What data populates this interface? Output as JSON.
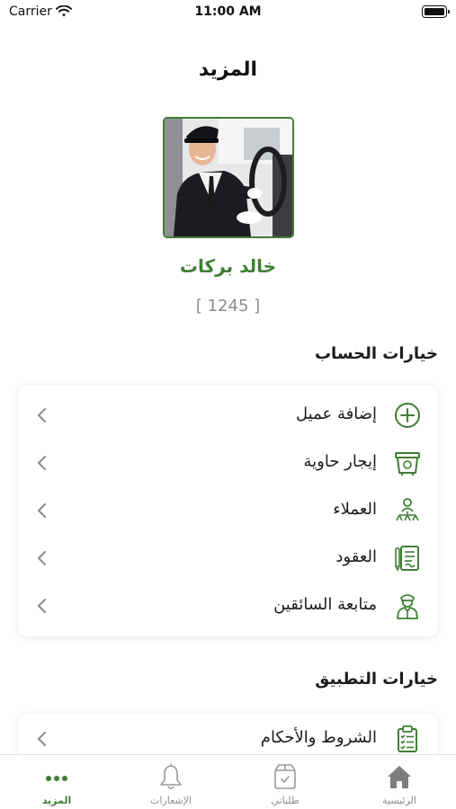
{
  "status_bar": {
    "carrier": "Carrier",
    "time": "11:00 AM"
  },
  "header": {
    "title": "المزيد"
  },
  "profile": {
    "name": "خالد بركات",
    "id_text": "[ 1245 ]"
  },
  "account_section": {
    "title": "خيارات الحساب",
    "items": [
      {
        "label": "إضافة عميل",
        "icon": "add-circle-icon"
      },
      {
        "label": "إيجار حاوية",
        "icon": "container-icon"
      },
      {
        "label": "العملاء",
        "icon": "customers-icon"
      },
      {
        "label": "العقود",
        "icon": "contracts-icon"
      },
      {
        "label": "متابعة السائقين",
        "icon": "driver-icon"
      }
    ]
  },
  "app_section": {
    "title": "خيارات التطبيق",
    "items": [
      {
        "label": "الشروط والأحكام",
        "icon": "clipboard-checklist-icon"
      }
    ]
  },
  "tab_bar": {
    "tabs": [
      {
        "label": "الرئيسية",
        "icon": "home-icon",
        "active": false
      },
      {
        "label": "طلباتي",
        "icon": "orders-box-icon",
        "active": false
      },
      {
        "label": "الإشعارات",
        "icon": "bell-icon",
        "active": false
      },
      {
        "label": "المزيد",
        "icon": "more-dots-icon",
        "active": true
      }
    ]
  },
  "colors": {
    "accent": "#3f7f33",
    "muted_text": "#8b8b8b",
    "inactive_tab": "#8e8e8e"
  }
}
